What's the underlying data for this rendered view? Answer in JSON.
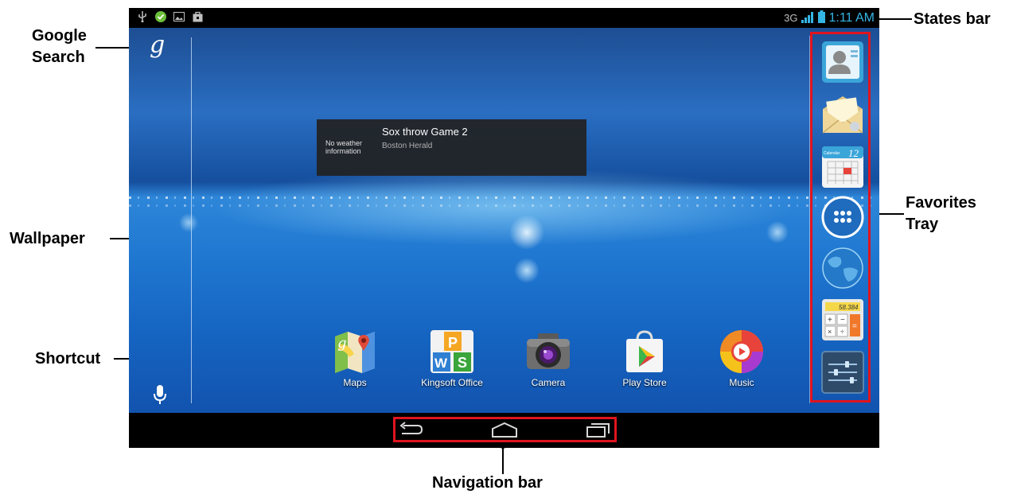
{
  "callouts": {
    "google_search": "Google\nSearch",
    "google_line1": "Google",
    "google_line2": "Search",
    "wallpaper": "Wallpaper",
    "shortcut": "Shortcut",
    "states_bar": "States bar",
    "favorites_line1": "Favorites",
    "favorites_line2": "Tray",
    "navigation_bar": "Navigation bar"
  },
  "status_bar": {
    "left_icons": [
      "usb-icon",
      "check-shield-icon",
      "picture-icon",
      "shopping-bag-icon"
    ],
    "network": "3G",
    "time": "1:11 AM"
  },
  "widget": {
    "weather": "No weather information",
    "headline": "Sox throw Game 2",
    "source": "Boston Herald"
  },
  "shortcuts": [
    {
      "label": "Maps",
      "icon": "maps-icon"
    },
    {
      "label": "Kingsoft Office",
      "icon": "kingsoft-office-icon"
    },
    {
      "label": "Camera",
      "icon": "camera-icon"
    },
    {
      "label": "Play Store",
      "icon": "play-store-icon"
    },
    {
      "label": "Music",
      "icon": "music-icon"
    }
  ],
  "favorites": [
    {
      "icon": "contacts-icon"
    },
    {
      "icon": "email-icon"
    },
    {
      "icon": "calendar-icon",
      "date": "12",
      "header": "Calendar"
    },
    {
      "icon": "app-drawer-icon"
    },
    {
      "icon": "browser-globe-icon"
    },
    {
      "icon": "calculator-icon",
      "display": "58.384"
    },
    {
      "icon": "settings-icon"
    }
  ],
  "navigation": [
    {
      "name": "back-button"
    },
    {
      "name": "home-button"
    },
    {
      "name": "recent-apps-button"
    }
  ],
  "colors": {
    "highlight": "#e0141e",
    "clock": "#35b5e5",
    "wallpaper": "#1f77d0"
  }
}
